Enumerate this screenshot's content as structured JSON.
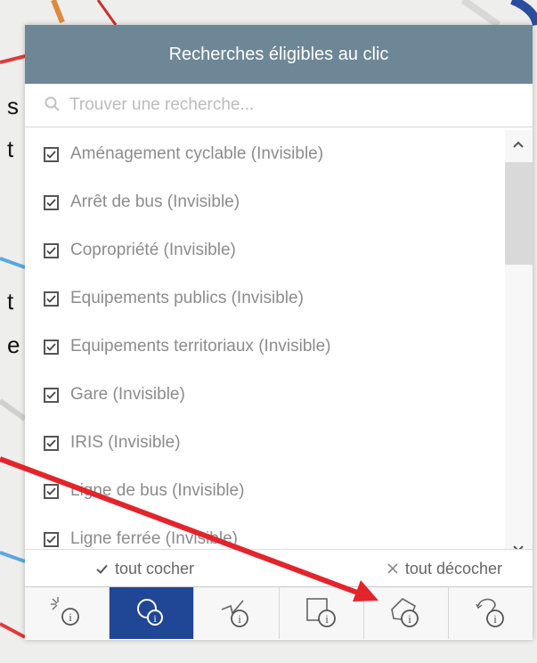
{
  "panel": {
    "title": "Recherches éligibles au clic",
    "search": {
      "placeholder": "Trouver une recherche..."
    },
    "items": [
      {
        "label": "Aménagement cyclable (Invisible)",
        "checked": true
      },
      {
        "label": "Arrêt de bus (Invisible)",
        "checked": true
      },
      {
        "label": "Copropriété (Invisible)",
        "checked": true
      },
      {
        "label": "Equipements publics (Invisible)",
        "checked": true
      },
      {
        "label": "Equipements territoriaux (Invisible)",
        "checked": true
      },
      {
        "label": "Gare (Invisible)",
        "checked": true
      },
      {
        "label": "IRIS (Invisible)",
        "checked": true
      },
      {
        "label": "Ligne de bus (Invisible)",
        "checked": true
      },
      {
        "label": "Ligne ferrée (Invisible)",
        "checked": true
      }
    ],
    "actions": {
      "check_all": "tout cocher",
      "uncheck_all": "tout décocher"
    },
    "tools": [
      {
        "icon": "click-info-icon",
        "active": false
      },
      {
        "icon": "circle-info-icon",
        "active": true
      },
      {
        "icon": "line-info-icon",
        "active": false
      },
      {
        "icon": "rectangle-info-icon",
        "active": false
      },
      {
        "icon": "polygon-info-icon",
        "active": false
      },
      {
        "icon": "freehand-info-icon",
        "active": false
      }
    ]
  },
  "background": {
    "letters": [
      "s",
      "t",
      "t",
      "e"
    ]
  },
  "colors": {
    "header": "#6d8796",
    "active_tool": "#1f4796",
    "annotation_arrow": "#e3242b"
  }
}
